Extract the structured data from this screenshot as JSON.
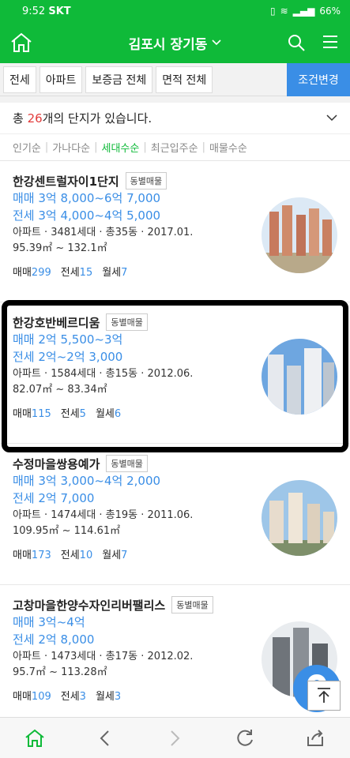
{
  "status": {
    "time": "9:52",
    "carrier": "SKT",
    "battery": "66%"
  },
  "header": {
    "title": "김포시 장기동"
  },
  "filters": {
    "items": [
      "전세",
      "아파트",
      "보증금 전체",
      "면적 전체"
    ],
    "condition_button": "조건변경"
  },
  "summary": {
    "prefix": "총 ",
    "count": "26",
    "suffix": "개의 단지가 있습니다."
  },
  "sort": {
    "options": [
      "인기순",
      "가나다순",
      "세대수순",
      "최근입주순",
      "매물수순"
    ],
    "active": "세대수순"
  },
  "listings": [
    {
      "name": "한강센트럴자이1단지",
      "badge": "동별매물",
      "sale": "매매 3억 8,000~6억 7,000",
      "jeonse": "전세 3억 4,000~4억 5,000",
      "info": "아파트 · 3481세대 · 총35동 · 2017.01.",
      "area": "95.39㎡ ~ 132.1㎡",
      "c_sale_label": "매매",
      "c_sale": "299",
      "c_jeonse_label": "전세",
      "c_jeonse": "15",
      "c_monthly_label": "월세",
      "c_monthly": "7"
    },
    {
      "name": "한강호반베르디움",
      "badge": "동별매물",
      "sale": "매매 2억 5,500~3억",
      "jeonse": "전세 2억~2억 3,000",
      "info": "아파트 · 1584세대 · 총15동 · 2012.06.",
      "area": "82.07㎡ ~ 83.34㎡",
      "c_sale_label": "매매",
      "c_sale": "115",
      "c_jeonse_label": "전세",
      "c_jeonse": "5",
      "c_monthly_label": "월세",
      "c_monthly": "6"
    },
    {
      "name": "수정마을쌍용예가",
      "badge": "동별매물",
      "sale": "매매 3억 3,000~4억 2,000",
      "jeonse": "전세 2억 7,000",
      "info": "아파트 · 1474세대 · 총19동 · 2011.06.",
      "area": "109.95㎡ ~ 114.61㎡",
      "c_sale_label": "매매",
      "c_sale": "173",
      "c_jeonse_label": "전세",
      "c_jeonse": "10",
      "c_monthly_label": "월세",
      "c_monthly": "7"
    },
    {
      "name": "고창마을한양수자인리버팰리스",
      "badge": "동별매물",
      "sale": "매매 3억~4억",
      "jeonse": "전세 2억 8,000",
      "info": "아파트 · 1473세대 · 총17동 · 2012.02.",
      "area": "95.7㎡ ~ 113.28㎡",
      "c_sale_label": "매매",
      "c_sale": "109",
      "c_jeonse_label": "전세",
      "c_jeonse": "3",
      "c_monthly_label": "월세",
      "c_monthly": "3"
    }
  ],
  "colors": {
    "brand": "#0fba39",
    "accent": "#3a8ee6",
    "count_red": "#e23b3b"
  }
}
